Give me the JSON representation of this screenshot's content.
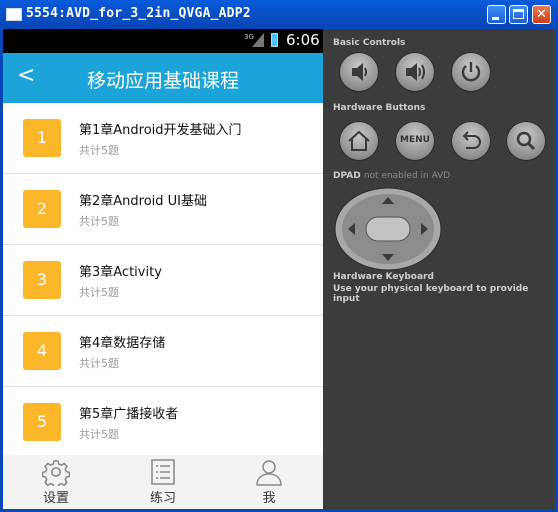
{
  "window": {
    "title": "5554:AVD_for_3_2in_QVGA_ADP2"
  },
  "status_bar": {
    "network": "3G",
    "time": "6:06"
  },
  "app_bar": {
    "title": "移动应用基础课程"
  },
  "chapters": [
    {
      "number": "1",
      "title": "第1章Android开发基础入门",
      "subtitle": "共计5题"
    },
    {
      "number": "2",
      "title": "第2章Android UI基础",
      "subtitle": "共计5题"
    },
    {
      "number": "3",
      "title": "第3章Activity",
      "subtitle": "共计5题"
    },
    {
      "number": "4",
      "title": "第4章数据存储",
      "subtitle": "共计5题"
    },
    {
      "number": "5",
      "title": "第5章广播接收者",
      "subtitle": "共计5题"
    }
  ],
  "bottom_nav": [
    {
      "label": "设置",
      "icon": "gear-icon"
    },
    {
      "label": "练习",
      "icon": "list-icon"
    },
    {
      "label": "我",
      "icon": "person-icon"
    }
  ],
  "controls": {
    "basic_label": "Basic Controls",
    "hardware_label": "Hardware Buttons",
    "menu_label": "MENU",
    "dpad_label": "DPAD",
    "dpad_note": "not enabled in AVD",
    "keyboard_label": "Hardware Keyboard",
    "keyboard_note": "Use your physical keyboard to provide input"
  },
  "colors": {
    "accent": "#1ca4d9",
    "badge": "#fbb62a",
    "titlebar": "#0850c8"
  }
}
